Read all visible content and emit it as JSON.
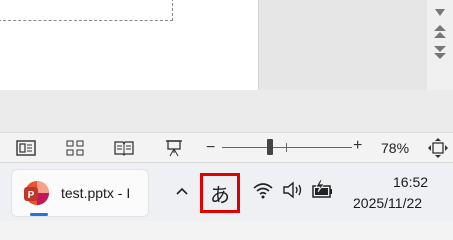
{
  "statusbar": {
    "zoom_minus": "−",
    "zoom_plus": "+",
    "zoom_level": "78%",
    "zoom_slider_value": 78,
    "views": [
      "normal-view-icon",
      "slide-sorter-icon",
      "reading-view-icon",
      "slide-show-icon"
    ]
  },
  "taskbar": {
    "app_label": "test.pptx - I",
    "ime_label": "あ",
    "time": "16:52",
    "date": "2025/11/22"
  },
  "colors": {
    "accent": "#2c6fd6",
    "highlight_box": "#e00000",
    "powerpoint_orange": "#d24726",
    "powerpoint_magenta": "#c2185b"
  }
}
